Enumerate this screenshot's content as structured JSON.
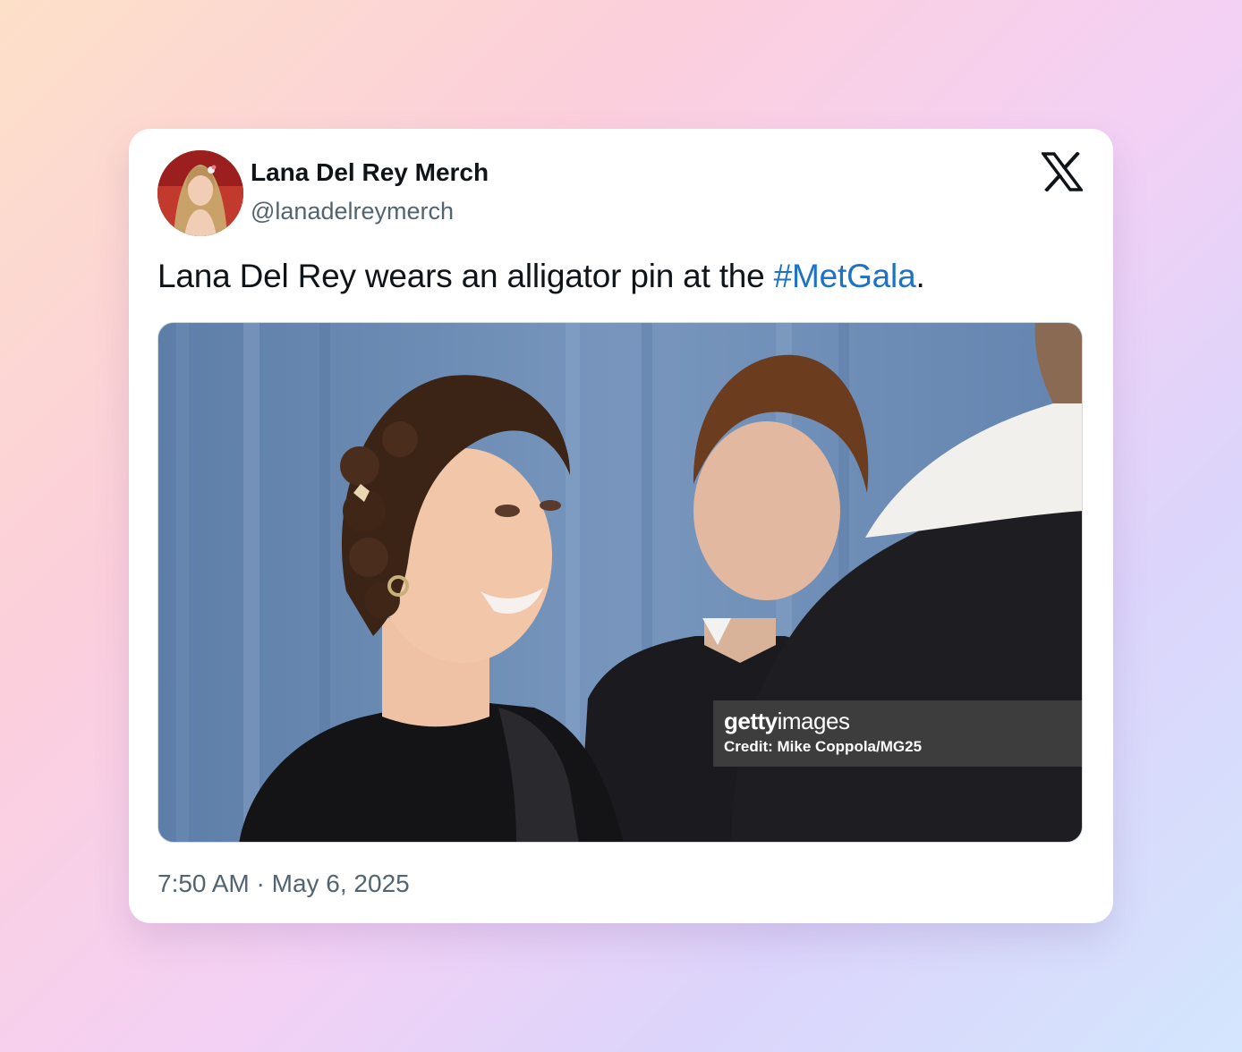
{
  "tweet": {
    "display_name": "Lana Del Rey Merch",
    "handle": "@lanadelreymerch",
    "text_before": "Lana Del Rey wears an alligator pin at the ",
    "hashtag": "#MetGala",
    "text_after": ".",
    "timestamp": "7:50 AM · May 6, 2025"
  },
  "media": {
    "watermark_brand_bold": "getty",
    "watermark_brand_light": "images",
    "watermark_credit": "Credit: Mike Coppola/MG25"
  },
  "icons": {
    "platform_logo": "x-logo-icon"
  },
  "colors": {
    "hashtag": "#1d72c8",
    "name": "#0f1419",
    "secondary": "#536471"
  }
}
